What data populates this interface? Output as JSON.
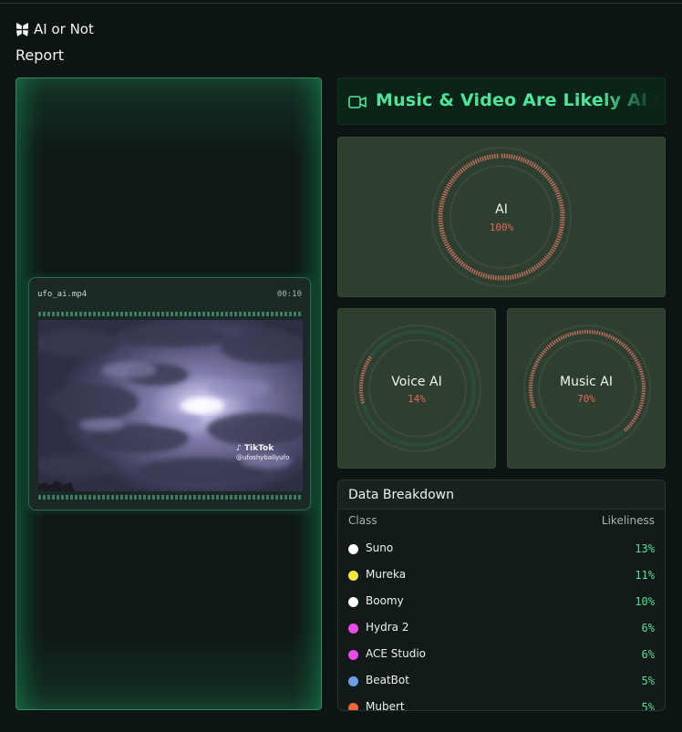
{
  "app": {
    "title": "AI or Not",
    "icon": "butterfly-logo-icon"
  },
  "page": {
    "heading": "Report"
  },
  "video": {
    "file_name": "ufo_ai.mp4",
    "duration": "00:10",
    "watermark_brand": "TikTok",
    "watermark_user": "@ufoshyballyufo"
  },
  "banner": {
    "text": "Music & Video Are Likely AI Generated",
    "icon": "video-camera-icon",
    "color": "#4ee59a"
  },
  "gauges": {
    "ai": {
      "label": "AI",
      "value_text": "100%",
      "value": 1.0
    },
    "voice": {
      "label": "Voice AI",
      "value_text": "14%",
      "value": 0.14
    },
    "music": {
      "label": "Music AI",
      "value_text": "70%",
      "value": 0.7
    }
  },
  "breakdown": {
    "title": "Data Breakdown",
    "col_class": "Class",
    "col_likeliness": "Likeliness",
    "rows": [
      {
        "name": "Suno",
        "pct": "13%",
        "color": "#ffffff"
      },
      {
        "name": "Mureka",
        "pct": "11%",
        "color": "#f5e642"
      },
      {
        "name": "Boomy",
        "pct": "10%",
        "color": "#ffffff"
      },
      {
        "name": "Hydra 2",
        "pct": "6%",
        "color": "#ea4ce6"
      },
      {
        "name": "ACE Studio",
        "pct": "6%",
        "color": "#ea4ce6"
      },
      {
        "name": "BeatBot",
        "pct": "5%",
        "color": "#6f9ee6"
      },
      {
        "name": "Mubert",
        "pct": "5%",
        "color": "#f0643c"
      }
    ]
  },
  "colors": {
    "accent": "#4ee59a",
    "danger": "#e4675e",
    "card": "#2f3f2f"
  }
}
